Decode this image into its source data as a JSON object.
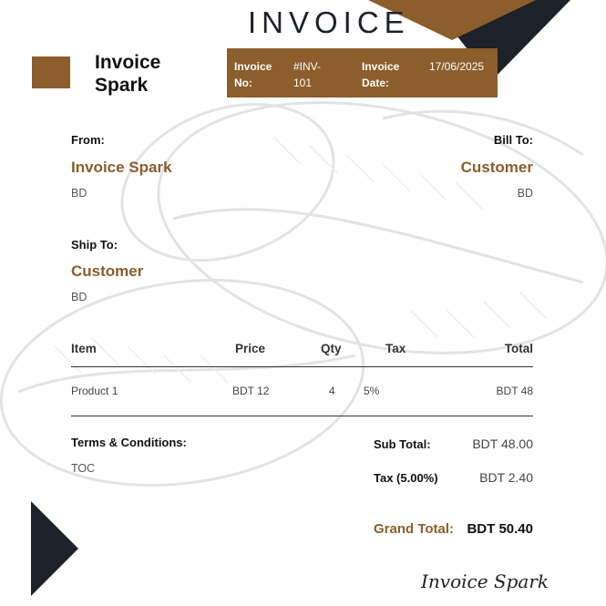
{
  "document": {
    "title": "INVOICE"
  },
  "brand": {
    "name": "Invoice Spark",
    "color": "#8b5e2c",
    "dark": "#1d2129"
  },
  "meta": {
    "invoice_no_label": "Invoice No:",
    "invoice_no_value": "#INV-101",
    "invoice_date_label": "Invoice Date:",
    "invoice_date_value": "17/06/2025"
  },
  "from": {
    "label": "From:",
    "name": "Invoice Spark",
    "country": "BD"
  },
  "bill_to": {
    "label": "Bill To:",
    "name": "Customer",
    "country": "BD"
  },
  "ship_to": {
    "label": "Ship To:",
    "name": "Customer",
    "country": "BD"
  },
  "table": {
    "headers": {
      "item": "Item",
      "price": "Price",
      "qty": "Qty",
      "tax": "Tax",
      "total": "Total"
    },
    "rows": [
      {
        "item": "Product 1",
        "price": "BDT 12",
        "qty": "4",
        "tax": "5%",
        "total": "BDT 48"
      }
    ]
  },
  "terms": {
    "label": "Terms & Conditions:",
    "text": "TOC"
  },
  "totals": {
    "subtotal_label": "Sub Total:",
    "subtotal_value": "BDT 48.00",
    "tax_label": "Tax (5.00%)",
    "tax_value": "BDT 2.40",
    "grand_label": "Grand Total:",
    "grand_value": "BDT 50.40"
  },
  "signature": "Invoice Spark",
  "background_image": "coffee-beans-sketch"
}
